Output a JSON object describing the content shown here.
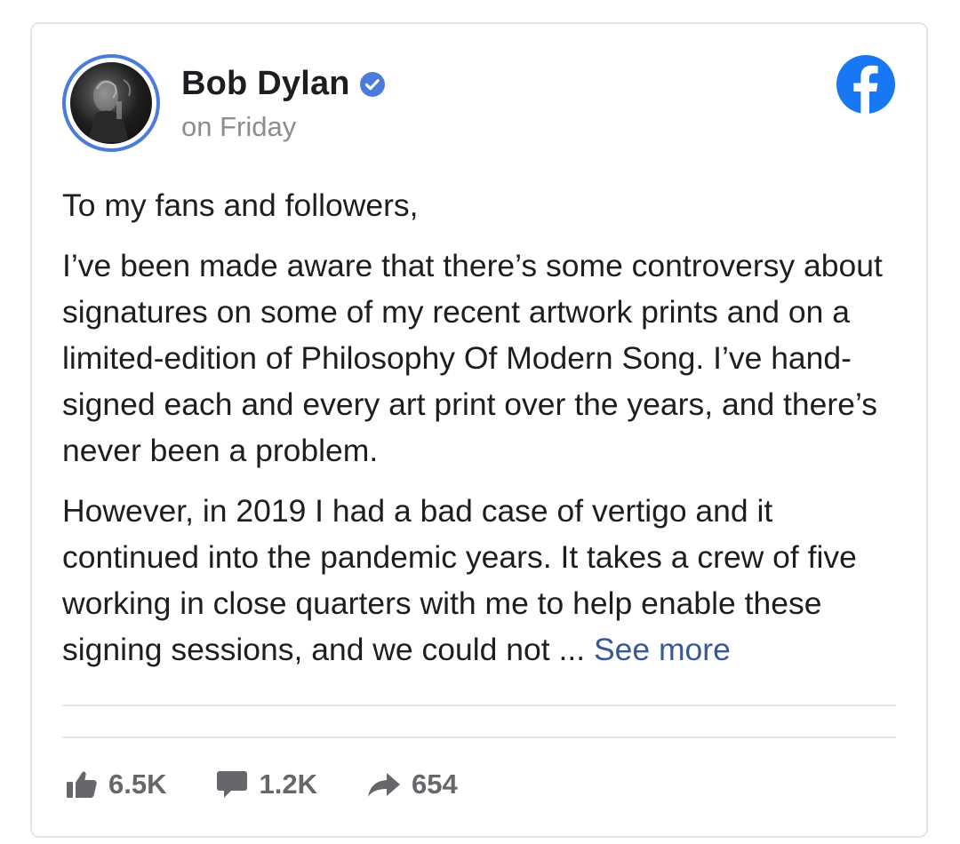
{
  "post": {
    "author": "Bob Dylan",
    "timestamp": "on Friday",
    "verified_icon": "verified-badge-icon",
    "platform_icon": "facebook-logo-icon",
    "paragraphs": {
      "p1": "To my fans and followers,",
      "p2": "I’ve been made aware that there’s some controversy about signatures on some of my recent artwork prints and on a limited-edition of Philosophy Of Modern Song. I’ve hand-signed each and every art print over the years, and there’s never been a problem.",
      "p3": "However, in 2019 I had a bad case of vertigo and it continued into the pandemic years. It takes a crew of five working in close quarters with me to help enable these signing sessions, and we could not ..."
    },
    "see_more_label": "See more"
  },
  "stats": {
    "likes": {
      "icon": "like-thumb-icon",
      "count": "6.5K"
    },
    "comments": {
      "icon": "comment-bubble-icon",
      "count": "1.2K"
    },
    "shares": {
      "icon": "share-arrow-icon",
      "count": "654"
    }
  },
  "colors": {
    "brand_blue": "#1877f2",
    "avatar_ring": "#4c7cd9",
    "link": "#385898",
    "muted_text": "#8a8d91",
    "stat_text": "#65676b",
    "card_border": "#e3e4e6"
  }
}
